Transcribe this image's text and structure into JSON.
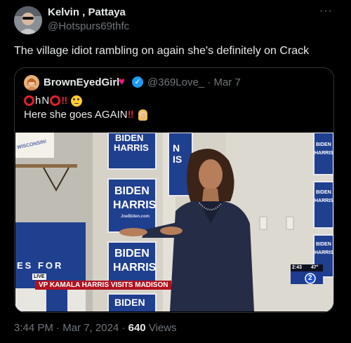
{
  "tweet": {
    "author_name": "Kelvin , Pattaya",
    "author_handle": "@Hotspurs69thfc",
    "more_label": "···",
    "text": "The village idiot rambling on again she's definitely on Crack",
    "time": "3:44 PM",
    "date": "Mar 7, 2024",
    "separator": "·",
    "views_count": "640",
    "views_label": "Views"
  },
  "quote": {
    "author_name": "BrownEyedGirl",
    "heart": "♥",
    "verified": "✓",
    "handle_date": "@369Love_ · Mar 7",
    "line1_letters": [
      "h",
      "N"
    ],
    "line1_bangs": "‼",
    "line2": "Here she goes AGAIN",
    "line2_bangs": "‼"
  },
  "video": {
    "live_tag": "LIVE",
    "lower_third": "VP KAMALA HARRIS VISITS MADISON",
    "clock": "2:43",
    "temp": "47°",
    "station": "2",
    "wall_banner": "WISCONSIN!",
    "poster_line1": "BIDEN",
    "poster_line2": "HARRIS",
    "poster_url": "JoeBiden.com",
    "foreground_banner": "ES FOR",
    "top_poster_partial": "N\nIS"
  },
  "colors": {
    "background": "#000000",
    "text": "#e7e9ea",
    "muted": "#71767b",
    "border": "#2f3336",
    "verified": "#1d9bf0",
    "heart": "#f91880",
    "alert_red": "#e0202e",
    "poster_blue": "#1f3f8f"
  },
  "icons": [
    "more-icon",
    "verified-badge-icon",
    "heart-icon",
    "red-circle-icon",
    "double-exclamation-icon",
    "eye-roll-face-icon",
    "facepalm-icon"
  ]
}
